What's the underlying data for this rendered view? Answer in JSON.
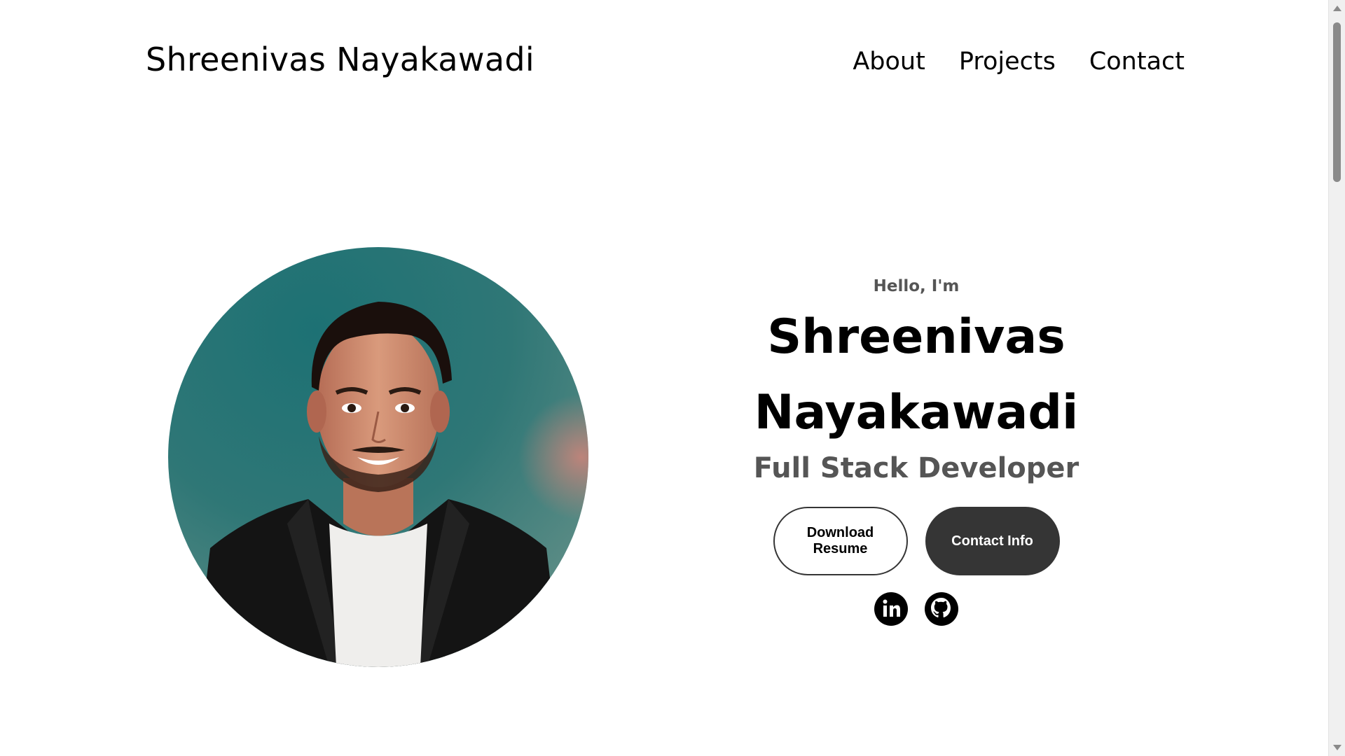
{
  "header": {
    "logo": "Shreenivas Nayakawadi",
    "nav": [
      {
        "label": "About"
      },
      {
        "label": "Projects"
      },
      {
        "label": "Contact"
      }
    ]
  },
  "hero": {
    "greeting": "Hello, I'm",
    "name_line1": "Shreenivas",
    "name_line2": "Nayakawadi",
    "role": "Full Stack Developer",
    "buttons": {
      "download": "Download Resume",
      "contact": "Contact Info"
    },
    "socials": [
      {
        "icon": "linkedin-icon"
      },
      {
        "icon": "github-icon"
      }
    ]
  },
  "colors": {
    "button_dark": "#353535",
    "muted_text": "#555555",
    "photo_background": "#2f7776"
  }
}
